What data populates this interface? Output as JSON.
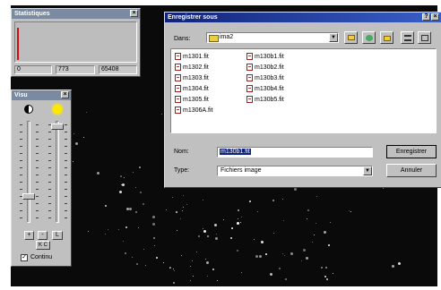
{
  "stats_window": {
    "title": "Statistiques",
    "close": "×",
    "values": [
      "0",
      "773",
      "65408"
    ]
  },
  "view_window": {
    "title": "Visu",
    "close": "×",
    "plus": "+",
    "minus": "-",
    "l_button": "L",
    "kc_button": "K C",
    "continu_label": "Continu",
    "continu_checked": true
  },
  "save_dialog": {
    "title": "Enregistrer sous",
    "help": "?",
    "close": "×",
    "dans_label": "Dans:",
    "folder": "ima2",
    "files_col1": [
      "m1301.fit",
      "m1302.fit",
      "m1303.fit",
      "m1304.fit",
      "m1305.fit",
      "m1306A.fit"
    ],
    "files_col2": [
      "m130b1.fit",
      "m130b2.fit",
      "m130b3.fit",
      "m130b4.fit",
      "m130b5.fit"
    ],
    "nom_label": "Nom:",
    "nom_value": "m130b1.fit",
    "type_label": "Type:",
    "type_value": "Fichiers image",
    "save_button": "Enregistrer",
    "cancel_button": "Annuler"
  },
  "colors": {
    "active_title": "#10237a",
    "inactive_title": "#7a8aa0",
    "face": "#c0c0c0",
    "selection": "#10237a"
  }
}
